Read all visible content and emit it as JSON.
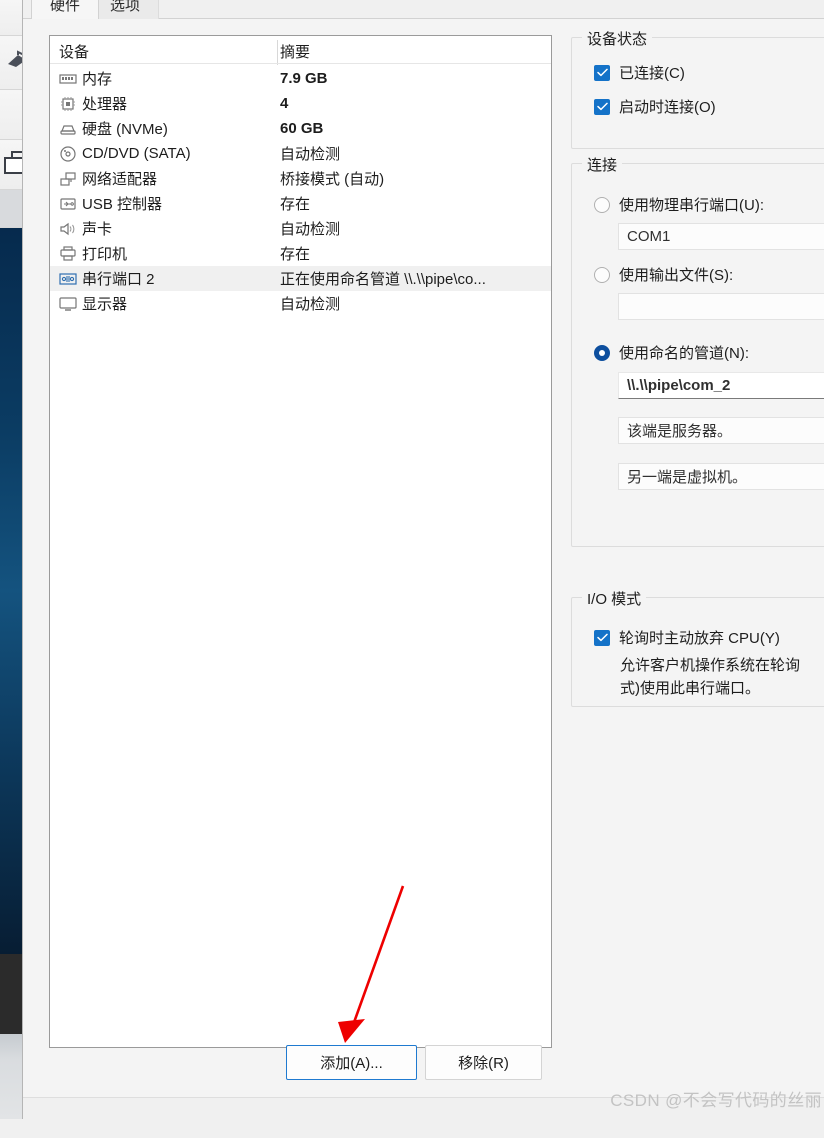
{
  "window": {
    "tabs": [
      {
        "label": "硬件",
        "active": true
      },
      {
        "label": "选项",
        "active": false
      }
    ]
  },
  "device_list": {
    "columns": [
      "设备",
      "摘要"
    ],
    "rows": [
      {
        "icon": "memory-icon",
        "device": "内存",
        "summary": "7.9 GB",
        "selected": false
      },
      {
        "icon": "cpu-icon",
        "device": "处理器",
        "summary": "4",
        "selected": false
      },
      {
        "icon": "harddisk-icon",
        "device": "硬盘 (NVMe)",
        "summary": "60 GB",
        "selected": false
      },
      {
        "icon": "cddvd-icon",
        "device": "CD/DVD (SATA)",
        "summary": "自动检测",
        "selected": false
      },
      {
        "icon": "network-icon",
        "device": "网络适配器",
        "summary": "桥接模式 (自动)",
        "selected": false
      },
      {
        "icon": "usb-icon",
        "device": "USB 控制器",
        "summary": "存在",
        "selected": false
      },
      {
        "icon": "sound-icon",
        "device": "声卡",
        "summary": "自动检测",
        "selected": false
      },
      {
        "icon": "printer-icon",
        "device": "打印机",
        "summary": "存在",
        "selected": false
      },
      {
        "icon": "serialport-icon",
        "device": "串行端口 2",
        "summary": "正在使用命名管道 \\\\.\\\\pipe\\co...",
        "selected": true
      },
      {
        "icon": "display-icon",
        "device": "显示器",
        "summary": "自动检测",
        "selected": false
      }
    ]
  },
  "device_status": {
    "title": "设备状态",
    "connected": {
      "label": "已连接(C)",
      "checked": true
    },
    "connect_at_power_on": {
      "label": "启动时连接(O)",
      "checked": true
    }
  },
  "connection": {
    "title": "连接",
    "use_physical_port": {
      "label": "使用物理串行端口(U):",
      "checked": false,
      "value": "COM1"
    },
    "use_output_file": {
      "label": "使用输出文件(S):",
      "checked": false,
      "value": ""
    },
    "use_named_pipe": {
      "label": "使用命名的管道(N):",
      "checked": true,
      "value": "\\\\.\\\\pipe\\com_2"
    },
    "end_role": "该端是服务器。",
    "other_end": "另一端是虚拟机。"
  },
  "io_mode": {
    "title": "I/O 模式",
    "yield_cpu": {
      "label": "轮询时主动放弃 CPU(Y)",
      "checked": true
    },
    "description_line1": "允许客户机操作系统在轮询",
    "description_line2": "式)使用此串行端口。"
  },
  "buttons": {
    "add": "添加(A)...",
    "remove": "移除(R)"
  },
  "watermark": "CSDN @不会写代码的丝丽",
  "colors": {
    "accent_checkbox": "#1472c8",
    "accent_radio": "#0d4f9e",
    "focus_border": "#1f7ad0",
    "annotation_arrow": "#ee0000",
    "selection_row": "#f0f0f0"
  }
}
